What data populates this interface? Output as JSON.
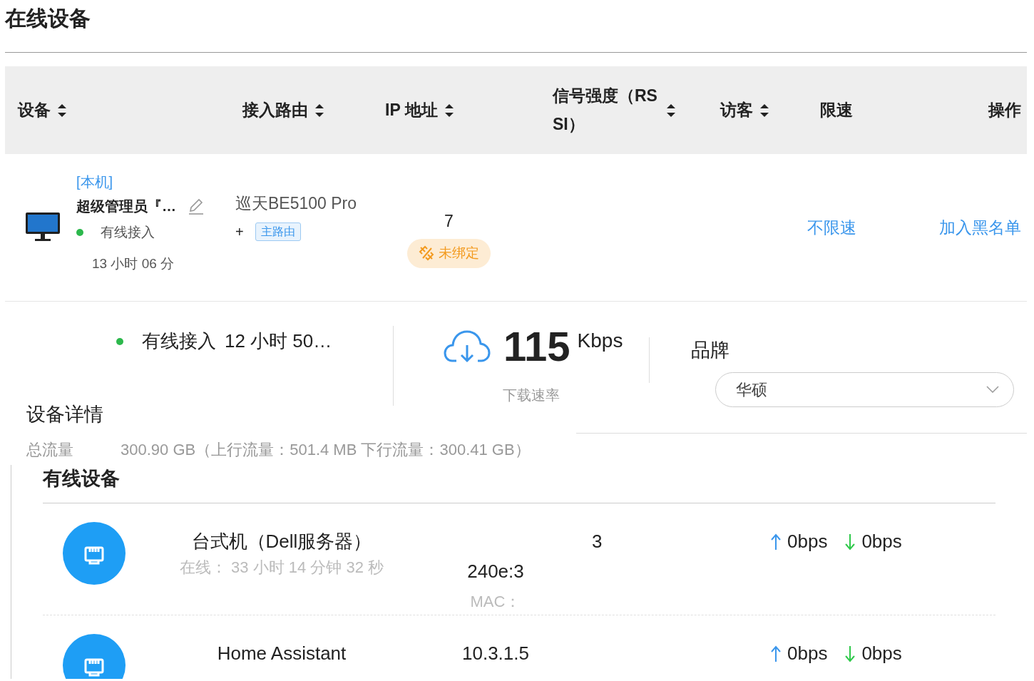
{
  "page_title": "在线设备",
  "table": {
    "columns": [
      {
        "label": "设备",
        "sortable": true
      },
      {
        "label": "接入路由",
        "sortable": true
      },
      {
        "label": "IP 地址",
        "sortable": true
      },
      {
        "label": "信号强度（RSSI）",
        "sortable": true
      },
      {
        "label": "访客",
        "sortable": true
      },
      {
        "label": "限速",
        "sortable": false
      },
      {
        "label": "操作",
        "sortable": false
      }
    ],
    "rows": [
      {
        "local_tag": "[本机]",
        "name": "超级管理员『…",
        "connection": "有线接入",
        "online_time": "13 小时 06 分",
        "router": "巡天BE5100 Pro",
        "router_add": "+",
        "router_tag": "主路由",
        "ip": "7",
        "bind_status": "未绑定",
        "speed_limit": "不限速",
        "action": "加入黑名单"
      }
    ]
  },
  "detail_strip": {
    "connection": "有线接入",
    "online_time": "12 小时 50…",
    "download_value": "115",
    "download_unit": "Kbps",
    "download_label": "下载速率",
    "brand_label": "品牌",
    "brand_value": "华硕"
  },
  "device_details": {
    "title": "设备详情",
    "total_label": "总流量",
    "total_value": "300.90 GB（上行流量：501.4 MB 下行流量：300.41 GB）"
  },
  "wired_devices": {
    "title": "有线设备",
    "items": [
      {
        "name": "台式机（Dell服务器）",
        "online": "在线：  33 小时 14 分钟 32 秒",
        "ip": "240e:3",
        "mac_label": "MAC：",
        "column_3": "3",
        "up": "0bps",
        "down": "0bps"
      },
      {
        "name": "Home Assistant",
        "ip": "10.3.1.5",
        "up": "0bps",
        "down": "0bps"
      }
    ]
  }
}
